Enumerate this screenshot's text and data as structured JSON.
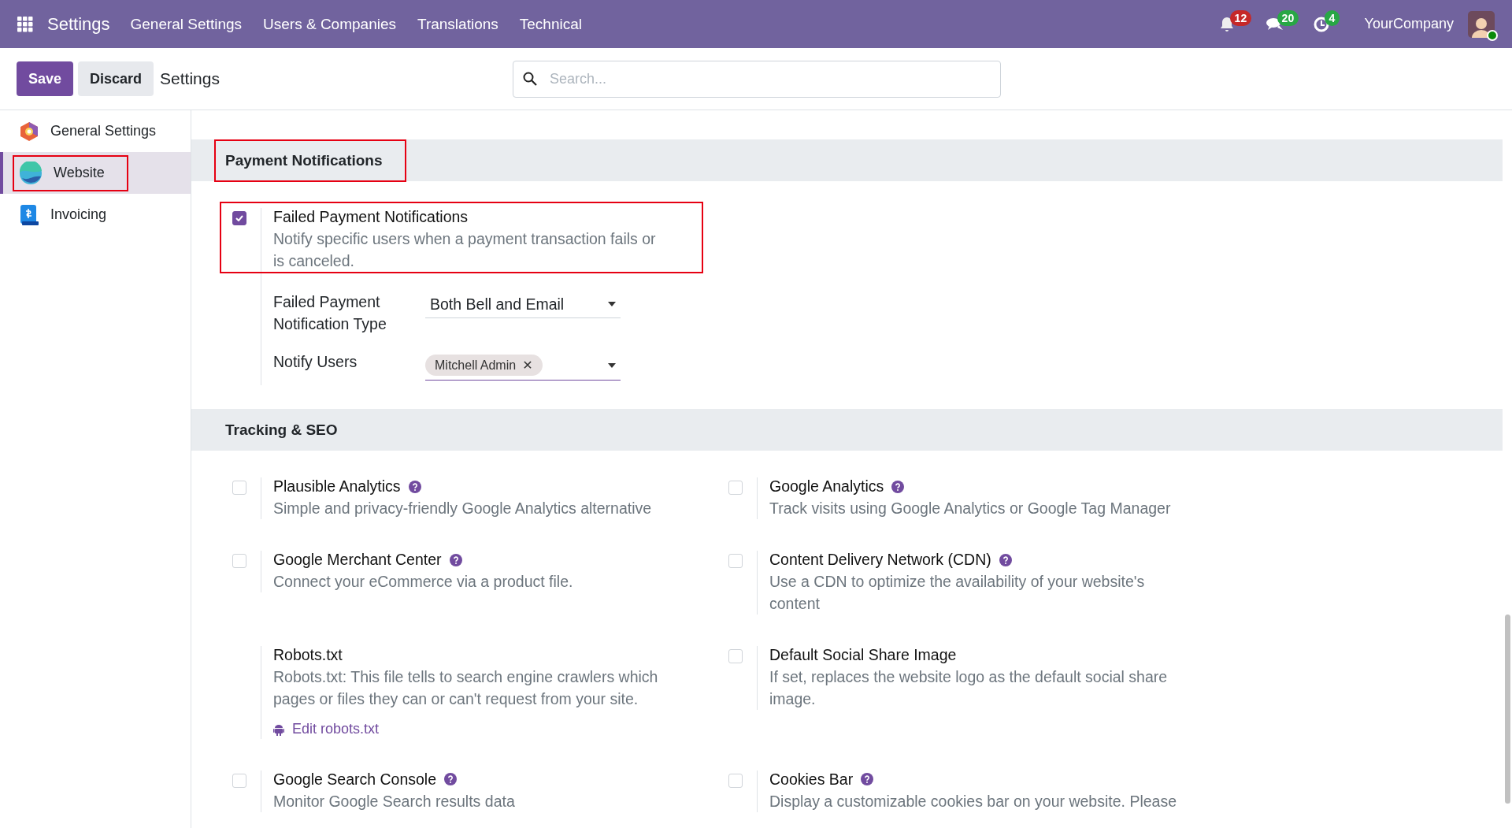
{
  "navbar": {
    "app": "Settings",
    "menu": [
      "General Settings",
      "Users & Companies",
      "Translations",
      "Technical"
    ],
    "systray": [
      {
        "kind": "bell",
        "count": "12",
        "color": "#c62828"
      },
      {
        "kind": "chat",
        "count": "20",
        "color": "#28a745"
      },
      {
        "kind": "clock",
        "count": "4",
        "color": "#28a745"
      }
    ],
    "company": "YourCompany"
  },
  "control_panel": {
    "save": "Save",
    "discard": "Discard",
    "title": "Settings",
    "search": {
      "placeholder": "Search..."
    }
  },
  "sidebar": {
    "items": [
      {
        "kind": "general",
        "label": "General Settings",
        "selected": false,
        "highlighted": false
      },
      {
        "kind": "website",
        "label": "Website",
        "selected": true,
        "highlighted": true
      },
      {
        "kind": "invoicing",
        "label": "Invoicing",
        "selected": false,
        "highlighted": false
      }
    ]
  },
  "sections": [
    {
      "title": "Payment Notifications",
      "highlighted": true,
      "settings": [
        {
          "kind": "checkbox",
          "title": "Failed Payment Notifications",
          "help": false,
          "checked": true,
          "highlighted": true,
          "description": "Notify specific users when a payment transaction fails or is canceled.",
          "fields": [
            {
              "kind": "select",
              "label": "Failed Payment Notification Type",
              "value": "Both Bell and Email"
            },
            {
              "kind": "tags",
              "label": "Notify Users",
              "tags": [
                {
                  "label": "Mitchell Admin",
                  "remove": "✕"
                }
              ]
            }
          ]
        }
      ]
    },
    {
      "title": "Tracking & SEO",
      "highlighted": false,
      "settings": [
        {
          "kind": "checkbox",
          "title": "Plausible Analytics",
          "help": true,
          "checked": false,
          "highlighted": false,
          "description": "Simple and privacy-friendly Google Analytics alternative"
        },
        {
          "kind": "checkbox",
          "title": "Google Analytics",
          "help": true,
          "checked": false,
          "highlighted": false,
          "description": "Track visits using Google Analytics or Google Tag Manager"
        },
        {
          "kind": "checkbox",
          "title": "Google Merchant Center",
          "help": true,
          "checked": false,
          "highlighted": false,
          "description": "Connect your eCommerce via a product file."
        },
        {
          "kind": "checkbox",
          "title": "Content Delivery Network (CDN)",
          "help": true,
          "checked": false,
          "highlighted": false,
          "description": "Use a CDN to optimize the availability of your website's content"
        },
        {
          "kind": "plain",
          "title": "Robots.txt",
          "help": false,
          "highlighted": false,
          "description": "Robots.txt: This file tells to search engine crawlers which pages or files they can or can't request from your site.",
          "link": "Edit robots.txt"
        },
        {
          "kind": "checkbox",
          "title": "Default Social Share Image",
          "help": false,
          "checked": false,
          "highlighted": false,
          "description": "If set, replaces the website logo as the default social share image."
        },
        {
          "kind": "checkbox",
          "title": "Google Search Console",
          "help": true,
          "checked": false,
          "highlighted": false,
          "description": "Monitor Google Search results data"
        },
        {
          "kind": "checkbox",
          "title": "Cookies Bar",
          "help": true,
          "checked": false,
          "highlighted": false,
          "description": "Display a customizable cookies bar on your website. Please"
        }
      ]
    }
  ]
}
